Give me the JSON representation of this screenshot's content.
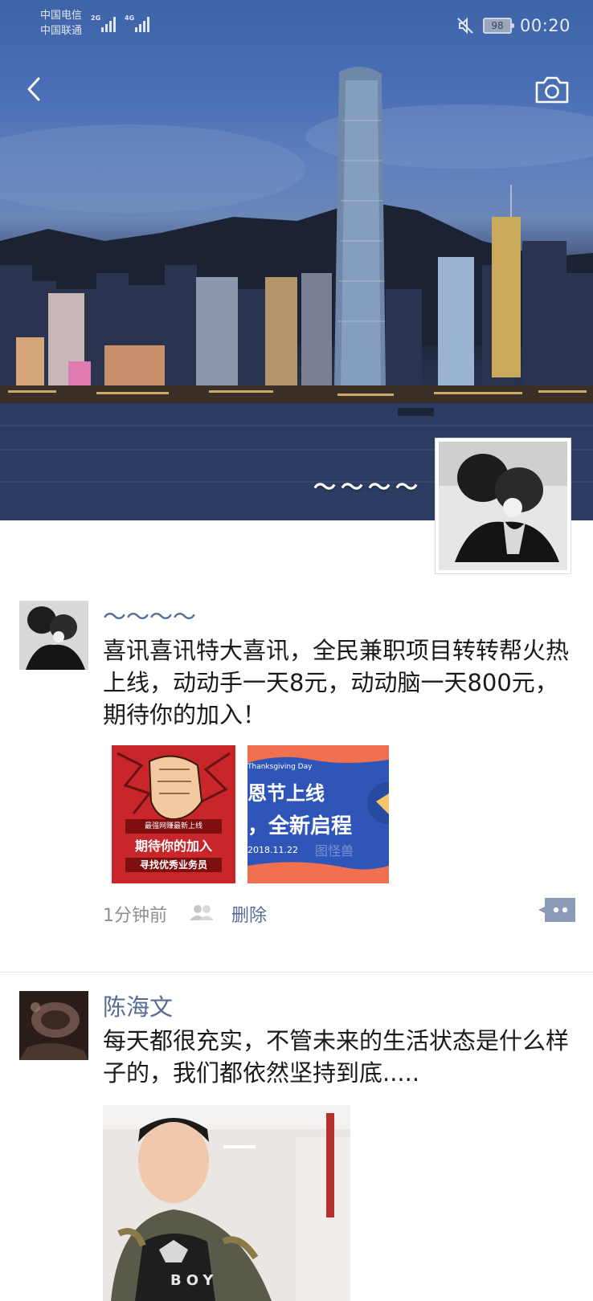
{
  "status_bar": {
    "carrier_1": "中国电信",
    "carrier_2": "中国联通",
    "net_1": "2G",
    "net_2": "4G",
    "battery": "98",
    "time": "00:20"
  },
  "header": {
    "back_icon": "chevron-left-icon",
    "camera_icon": "camera-icon",
    "user_name": "～～～～"
  },
  "posts": [
    {
      "author": "～～～～",
      "text": "喜讯喜讯特大喜讯，全民兼职项目转转帮火热上线，动动手一天8元，动动脑一天800元，期待你的加入！",
      "images": [
        {
          "line_1": "最强网赚最新上线",
          "line_2": "期待你的加入",
          "line_3": "寻找优秀业务员"
        },
        {
          "line_1": "Thanksgiving Day",
          "line_2": "恩节上线",
          "line_3": "，全新启程",
          "line_4": "2018.11.22",
          "watermark": "图怪兽"
        }
      ],
      "time_ago": "1分钟前",
      "delete_label": "删除"
    },
    {
      "author": "陈海文",
      "text": "每天都很充实，不管未来的生活状态是什么样子的，我们都依然坚持到底.....",
      "photo_caption": "BOY"
    }
  ],
  "colors": {
    "link": "#576b95",
    "meta_gray": "#8e8e8e",
    "poster_red": "#c8262a",
    "poster_blue": "#2f55b8",
    "poster_orange": "#f07050"
  }
}
